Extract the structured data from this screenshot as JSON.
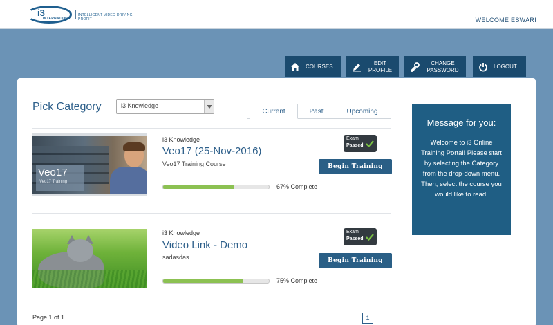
{
  "header": {
    "logo_text": "i3",
    "logo_sub": "INTERNATIONAL",
    "logo_tagline": "INTELLIGENT VIDEO DRIVING PROFIT",
    "welcome": "WELCOME ESWARI"
  },
  "nav": {
    "courses": "COURSES",
    "edit_profile": "EDIT PROFILE",
    "change_password": "CHANGE PASSWORD",
    "logout": "LOGOUT"
  },
  "pick": {
    "title": "Pick Category",
    "selected": "i3 Knowledge"
  },
  "tabs": [
    "Current",
    "Past",
    "Upcoming"
  ],
  "courses": [
    {
      "category": "i3 Knowledge",
      "title": "Veo17 (25-Nov-2016)",
      "subtitle": "Veo17 Training Course",
      "thumb_caption": "Veo17",
      "thumb_caption_small": "Veo17 Training",
      "progress": 0.67,
      "progress_text": "67% Complete",
      "exam_label": "Exam",
      "exam_status": "Passed",
      "button": "Begin Training"
    },
    {
      "category": "i3 Knowledge",
      "title": "Video Link - Demo",
      "subtitle": "sadasdas",
      "progress": 0.75,
      "progress_text": "75% Complete",
      "exam_label": "Exam",
      "exam_status": "Passed",
      "button": "Begin Training"
    }
  ],
  "pagination": {
    "info": "Page 1 of 1",
    "current": "1"
  },
  "message": {
    "title": "Message for you:",
    "body": "Welcome to i3 Online Training Portal! Please start by selecting the Category from the drop-down menu. Then, select the course you would like to read."
  },
  "colors": {
    "background": "#6b93b6",
    "nav": "#1a4a6e",
    "accent": "#2d5f8a",
    "progress": "#8cc152",
    "message_bg": "#1f5e84"
  }
}
